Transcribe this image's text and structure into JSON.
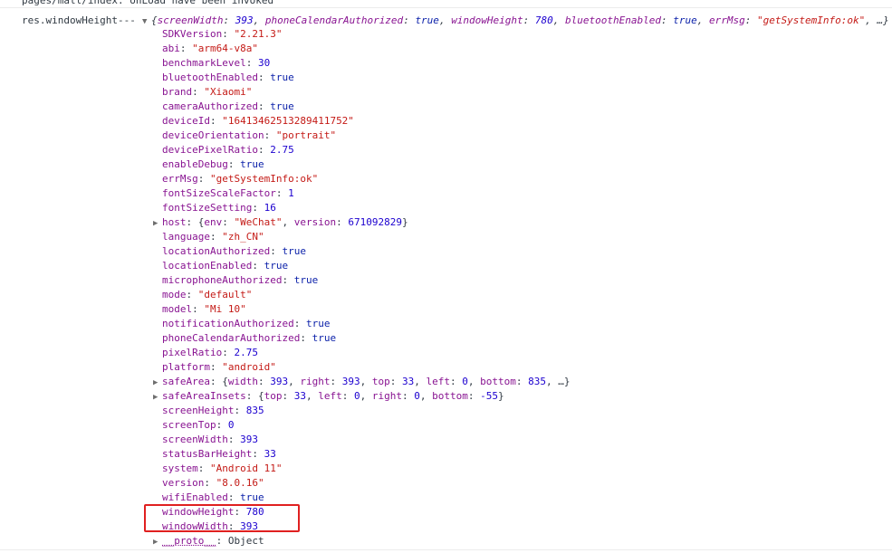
{
  "previous_log": "pages/mall/index: onLoad have been invoked",
  "log": {
    "label": "res.windowHeight---",
    "summary": [
      {
        "k": "screenWidth",
        "v": "393",
        "t": "num"
      },
      {
        "k": "phoneCalendarAuthorized",
        "v": "true",
        "t": "bool"
      },
      {
        "k": "windowHeight",
        "v": "780",
        "t": "num"
      },
      {
        "k": "bluetoothEnabled",
        "v": "true",
        "t": "bool"
      },
      {
        "k": "errMsg",
        "v": "\"getSystemInfo:ok\"",
        "t": "str"
      }
    ],
    "summary_open": "{",
    "summary_close": ", …}",
    "properties": [
      {
        "key": "SDKVersion",
        "value": "\"2.21.3\"",
        "type": "str"
      },
      {
        "key": "abi",
        "value": "\"arm64-v8a\"",
        "type": "str"
      },
      {
        "key": "benchmarkLevel",
        "value": "30",
        "type": "num"
      },
      {
        "key": "bluetoothEnabled",
        "value": "true",
        "type": "bool"
      },
      {
        "key": "brand",
        "value": "\"Xiaomi\"",
        "type": "str"
      },
      {
        "key": "cameraAuthorized",
        "value": "true",
        "type": "bool"
      },
      {
        "key": "deviceId",
        "value": "\"16413462513289411752\"",
        "type": "str"
      },
      {
        "key": "deviceOrientation",
        "value": "\"portrait\"",
        "type": "str"
      },
      {
        "key": "devicePixelRatio",
        "value": "2.75",
        "type": "num"
      },
      {
        "key": "enableDebug",
        "value": "true",
        "type": "bool"
      },
      {
        "key": "errMsg",
        "value": "\"getSystemInfo:ok\"",
        "type": "str"
      },
      {
        "key": "fontSizeScaleFactor",
        "value": "1",
        "type": "num"
      },
      {
        "key": "fontSizeSetting",
        "value": "16",
        "type": "num"
      },
      {
        "key": "host",
        "type": "obj",
        "expandable": true,
        "parts": [
          {
            "t": "plain",
            "v": "{"
          },
          {
            "t": "key",
            "v": "env"
          },
          {
            "t": "plain",
            "v": ": "
          },
          {
            "t": "str",
            "v": "\"WeChat\""
          },
          {
            "t": "plain",
            "v": ", "
          },
          {
            "t": "key",
            "v": "version"
          },
          {
            "t": "plain",
            "v": ": "
          },
          {
            "t": "num",
            "v": "671092829"
          },
          {
            "t": "plain",
            "v": "}"
          }
        ]
      },
      {
        "key": "language",
        "value": "\"zh_CN\"",
        "type": "str"
      },
      {
        "key": "locationAuthorized",
        "value": "true",
        "type": "bool"
      },
      {
        "key": "locationEnabled",
        "value": "true",
        "type": "bool"
      },
      {
        "key": "microphoneAuthorized",
        "value": "true",
        "type": "bool"
      },
      {
        "key": "mode",
        "value": "\"default\"",
        "type": "str"
      },
      {
        "key": "model",
        "value": "\"Mi 10\"",
        "type": "str"
      },
      {
        "key": "notificationAuthorized",
        "value": "true",
        "type": "bool"
      },
      {
        "key": "phoneCalendarAuthorized",
        "value": "true",
        "type": "bool"
      },
      {
        "key": "pixelRatio",
        "value": "2.75",
        "type": "num"
      },
      {
        "key": "platform",
        "value": "\"android\"",
        "type": "str"
      },
      {
        "key": "safeArea",
        "type": "obj",
        "expandable": true,
        "parts": [
          {
            "t": "plain",
            "v": "{"
          },
          {
            "t": "key",
            "v": "width"
          },
          {
            "t": "plain",
            "v": ": "
          },
          {
            "t": "num",
            "v": "393"
          },
          {
            "t": "plain",
            "v": ", "
          },
          {
            "t": "key",
            "v": "right"
          },
          {
            "t": "plain",
            "v": ": "
          },
          {
            "t": "num",
            "v": "393"
          },
          {
            "t": "plain",
            "v": ", "
          },
          {
            "t": "key",
            "v": "top"
          },
          {
            "t": "plain",
            "v": ": "
          },
          {
            "t": "num",
            "v": "33"
          },
          {
            "t": "plain",
            "v": ", "
          },
          {
            "t": "key",
            "v": "left"
          },
          {
            "t": "plain",
            "v": ": "
          },
          {
            "t": "num",
            "v": "0"
          },
          {
            "t": "plain",
            "v": ", "
          },
          {
            "t": "key",
            "v": "bottom"
          },
          {
            "t": "plain",
            "v": ": "
          },
          {
            "t": "num",
            "v": "835"
          },
          {
            "t": "plain",
            "v": ", …}"
          }
        ]
      },
      {
        "key": "safeAreaInsets",
        "type": "obj",
        "expandable": true,
        "parts": [
          {
            "t": "plain",
            "v": "{"
          },
          {
            "t": "key",
            "v": "top"
          },
          {
            "t": "plain",
            "v": ": "
          },
          {
            "t": "num",
            "v": "33"
          },
          {
            "t": "plain",
            "v": ", "
          },
          {
            "t": "key",
            "v": "left"
          },
          {
            "t": "plain",
            "v": ": "
          },
          {
            "t": "num",
            "v": "0"
          },
          {
            "t": "plain",
            "v": ", "
          },
          {
            "t": "key",
            "v": "right"
          },
          {
            "t": "plain",
            "v": ": "
          },
          {
            "t": "num",
            "v": "0"
          },
          {
            "t": "plain",
            "v": ", "
          },
          {
            "t": "key",
            "v": "bottom"
          },
          {
            "t": "plain",
            "v": ": "
          },
          {
            "t": "num",
            "v": "-55"
          },
          {
            "t": "plain",
            "v": "}"
          }
        ]
      },
      {
        "key": "screenHeight",
        "value": "835",
        "type": "num"
      },
      {
        "key": "screenTop",
        "value": "0",
        "type": "num"
      },
      {
        "key": "screenWidth",
        "value": "393",
        "type": "num"
      },
      {
        "key": "statusBarHeight",
        "value": "33",
        "type": "num"
      },
      {
        "key": "system",
        "value": "\"Android 11\"",
        "type": "str"
      },
      {
        "key": "version",
        "value": "\"8.0.16\"",
        "type": "str"
      },
      {
        "key": "wifiEnabled",
        "value": "true",
        "type": "bool"
      },
      {
        "key": "windowHeight",
        "value": "780",
        "type": "num"
      },
      {
        "key": "windowWidth",
        "value": "393",
        "type": "num"
      },
      {
        "key": "__proto__",
        "value": "Object",
        "type": "plain",
        "expandable": true,
        "proto": true
      }
    ]
  },
  "colors": {
    "key": "#881391",
    "string": "#c41a16",
    "number": "#1c00cf",
    "boolean": "#0d22aa",
    "highlight": "#e02020"
  }
}
